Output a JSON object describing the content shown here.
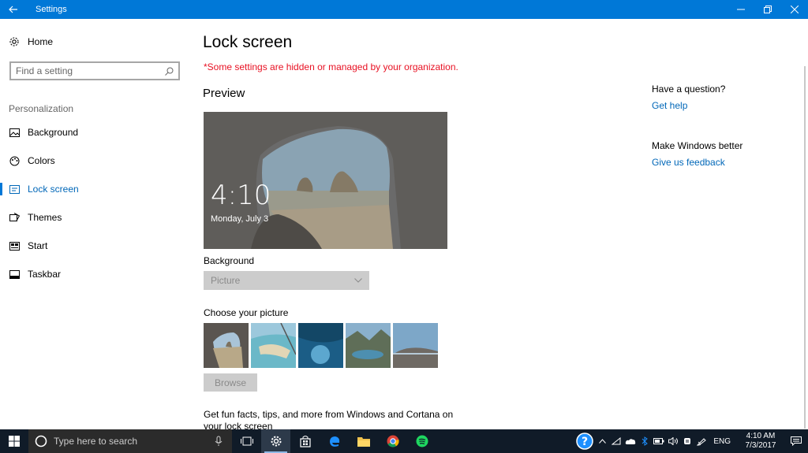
{
  "window": {
    "title": "Settings"
  },
  "sidebar": {
    "home_label": "Home",
    "search_placeholder": "Find a setting",
    "section_label": "Personalization",
    "items": [
      {
        "label": "Background",
        "icon": "picture-icon"
      },
      {
        "label": "Colors",
        "icon": "palette-icon"
      },
      {
        "label": "Lock screen",
        "icon": "lock-screen-icon",
        "active": true
      },
      {
        "label": "Themes",
        "icon": "themes-icon"
      },
      {
        "label": "Start",
        "icon": "start-icon"
      },
      {
        "label": "Taskbar",
        "icon": "taskbar-icon"
      }
    ]
  },
  "main": {
    "title": "Lock screen",
    "warning": "*Some settings are hidden or managed by your organization.",
    "preview_label": "Preview",
    "preview_time": "4:10",
    "preview_date": "Monday, July 3",
    "background_label": "Background",
    "background_value": "Picture",
    "choose_label": "Choose your picture",
    "browse_label": "Browse",
    "funfacts": "Get fun facts, tips, and more from Windows and Cortana on your lock screen"
  },
  "right": {
    "question": "Have a question?",
    "get_help": "Get help",
    "better": "Make Windows better",
    "feedback": "Give us feedback"
  },
  "taskbar": {
    "search_placeholder": "Type here to search",
    "lang": "ENG",
    "time": "4:10 AM",
    "date": "7/3/2017"
  },
  "colors": {
    "accent": "#0078d7",
    "warning": "#e81123",
    "link": "#0067b8",
    "taskbar": "#101b28"
  }
}
